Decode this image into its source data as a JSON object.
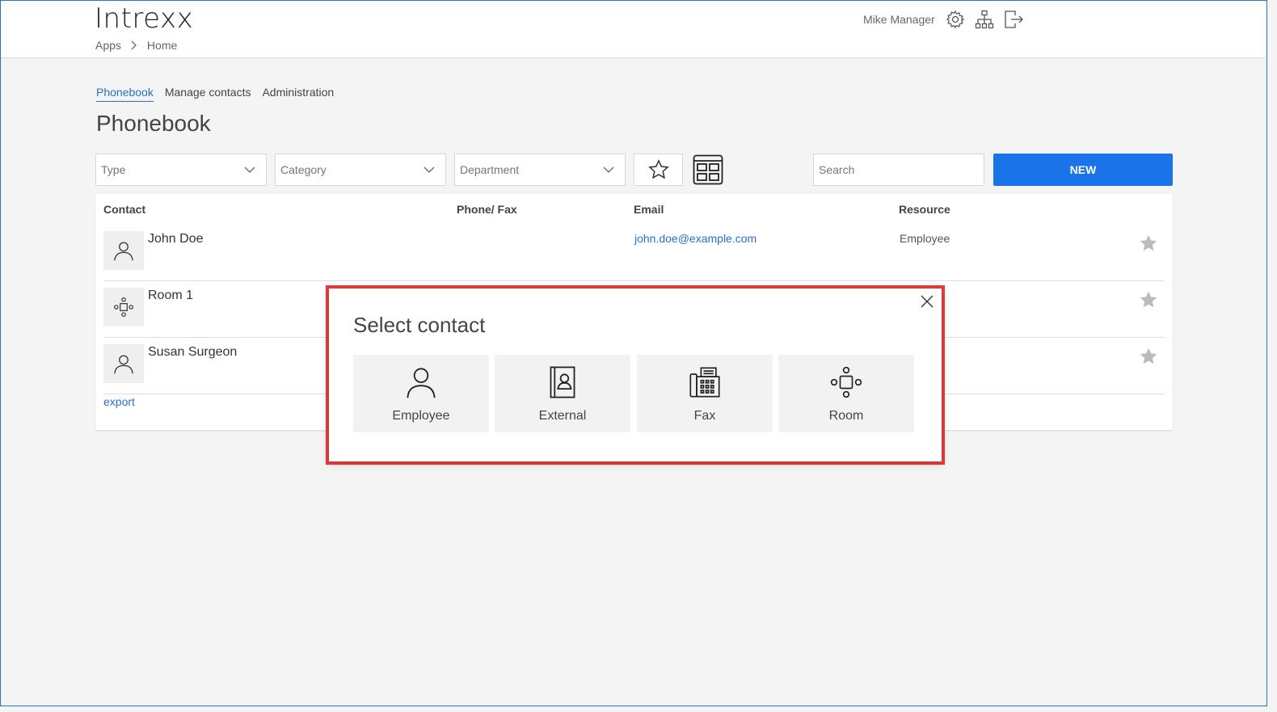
{
  "header": {
    "logo": "Intrexx",
    "breadcrumb": [
      "Apps",
      "Home"
    ],
    "user_name": "Mike Manager",
    "icons": [
      "gear-icon",
      "sitemap-icon",
      "logout-icon"
    ]
  },
  "tabs": [
    {
      "label": "Phonebook",
      "active": true
    },
    {
      "label": "Manage contacts",
      "active": false
    },
    {
      "label": "Administration",
      "active": false
    }
  ],
  "page_title": "Phonebook",
  "filters": {
    "type": "Type",
    "category": "Category",
    "department": "Department",
    "search_placeholder": "Search",
    "new_label": "NEW"
  },
  "table": {
    "headers": [
      "Contact",
      "Phone/ Fax",
      "Email",
      "Resource"
    ],
    "rows": [
      {
        "name": "John Doe",
        "phone": "",
        "email": "john.doe@example.com",
        "resource": "Employee",
        "icon": "person-icon"
      },
      {
        "name": "Room 1",
        "phone": "",
        "email": "",
        "resource": "",
        "icon": "room-icon"
      },
      {
        "name": "Susan Surgeon",
        "phone": "",
        "email": "",
        "resource": "e",
        "icon": "person-icon"
      }
    ],
    "export_label": "export"
  },
  "modal": {
    "title": "Select contact",
    "options": [
      {
        "label": "Employee",
        "icon": "person-icon"
      },
      {
        "label": "External",
        "icon": "contact-book-icon"
      },
      {
        "label": "Fax",
        "icon": "fax-icon"
      },
      {
        "label": "Room",
        "icon": "room-icon"
      }
    ]
  },
  "colors": {
    "accent": "#1a73e8",
    "link": "#2a6fc9",
    "highlight": "#ee3b3b"
  }
}
